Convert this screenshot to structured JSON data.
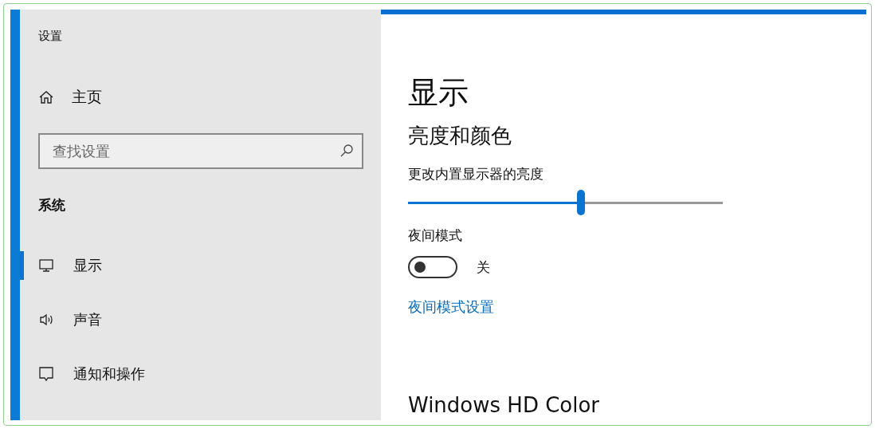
{
  "window": {
    "title": "设置"
  },
  "sidebar": {
    "home": {
      "label": "主页"
    },
    "search": {
      "placeholder": "查找设置"
    },
    "section": "系统",
    "items": [
      {
        "kind": "display",
        "label": "显示",
        "selected": true
      },
      {
        "kind": "sound",
        "label": "声音",
        "selected": false
      },
      {
        "kind": "notification",
        "label": "通知和操作",
        "selected": false
      }
    ]
  },
  "content": {
    "title": "显示",
    "section": "亮度和颜色",
    "brightness": {
      "label": "更改内置显示器的亮度",
      "level": 0.55
    },
    "night_mode": {
      "label": "夜间模式",
      "on": false,
      "state": "关"
    },
    "link": "夜间模式设置",
    "next_section": "Windows HD Color"
  }
}
